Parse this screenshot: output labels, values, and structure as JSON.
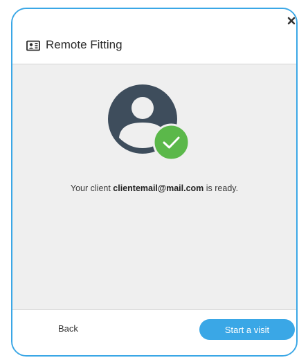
{
  "dialog": {
    "title": "Remote Fitting",
    "title_icon": "video-call-icon",
    "close_icon": "close-icon",
    "accent_color": "#3aa7e6"
  },
  "main": {
    "avatar_icon": "user-avatar-icon",
    "status_icon": "check-icon",
    "status_color": "#5bb84a",
    "message_prefix": "Your client ",
    "client_email": "clientemail@mail.com",
    "message_suffix": " is ready."
  },
  "footer": {
    "back_label": "Back",
    "start_label": "Start a visit"
  }
}
